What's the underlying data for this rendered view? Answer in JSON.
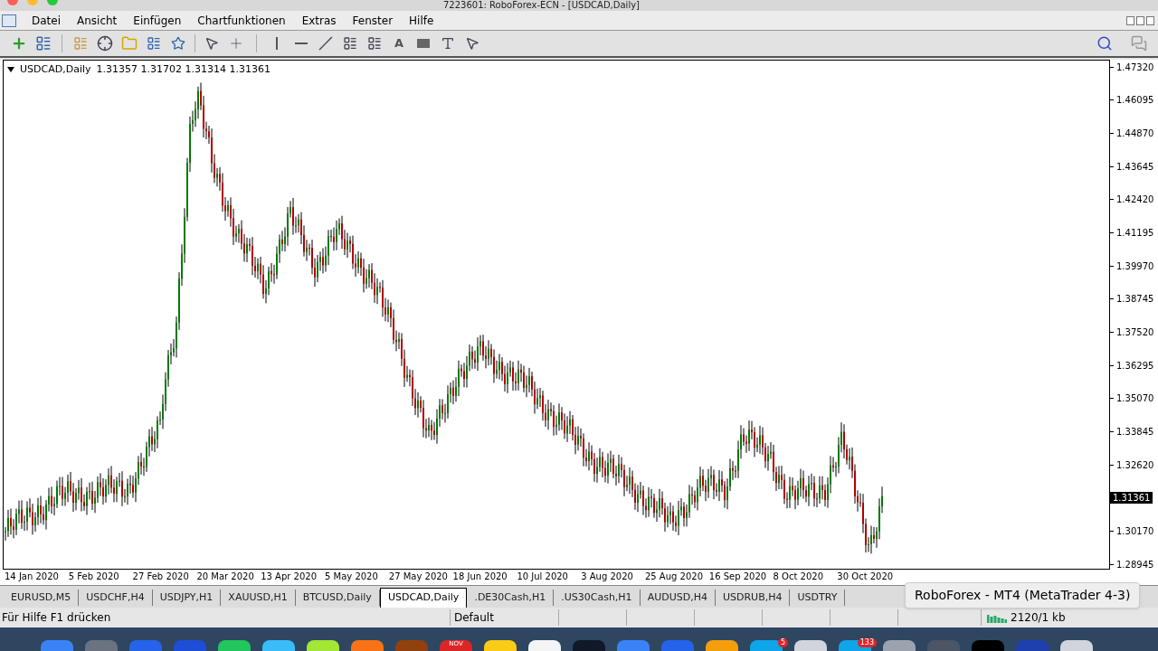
{
  "window": {
    "title": "7223601: RoboForex-ECN - [USDCAD,Daily]"
  },
  "menu": [
    "Datei",
    "Ansicht",
    "Einfügen",
    "Chartfunktionen",
    "Extras",
    "Fenster",
    "Hilfe"
  ],
  "toolbar": {
    "text_tool_label": "A"
  },
  "chart": {
    "symbol": "USDCAD,Daily",
    "ohlc": "1.31357 1.31702 1.31314 1.31361",
    "y_labels": [
      {
        "kind": "tick",
        "label": "1.47320"
      },
      {
        "kind": "tick",
        "label": "1.46095"
      },
      {
        "kind": "tick",
        "label": "1.44870"
      },
      {
        "kind": "tick",
        "label": "1.43645"
      },
      {
        "kind": "tick",
        "label": "1.42420"
      },
      {
        "kind": "tick",
        "label": "1.41195"
      },
      {
        "kind": "tick",
        "label": "1.39970"
      },
      {
        "kind": "tick",
        "label": "1.38745"
      },
      {
        "kind": "tick",
        "label": "1.37520"
      },
      {
        "kind": "tick",
        "label": "1.36295"
      },
      {
        "kind": "tick",
        "label": "1.35070"
      },
      {
        "kind": "tick",
        "label": "1.33845"
      },
      {
        "kind": "tick",
        "label": "1.32620"
      },
      {
        "kind": "current",
        "label": "1.31361"
      },
      {
        "kind": "tick",
        "label": "1.30170"
      },
      {
        "kind": "tick",
        "label": "1.28945"
      }
    ],
    "x_labels": [
      "14 Jan 2020",
      "5 Feb 2020",
      "27 Feb 2020",
      "20 Mar 2020",
      "13 Apr 2020",
      "5 May 2020",
      "27 May 2020",
      "18 Jun 2020",
      "10 Jul 2020",
      "3 Aug 2020",
      "25 Aug 2020",
      "16 Sep 2020",
      "8 Oct 2020",
      "30 Oct 2020"
    ]
  },
  "tabs": [
    {
      "label": "EURUSD,M5",
      "selected": false
    },
    {
      "label": "USDCHF,H4",
      "selected": false
    },
    {
      "label": "USDJPY,H1",
      "selected": false
    },
    {
      "label": "XAUUSD,H1",
      "selected": false
    },
    {
      "label": "BTCUSD,Daily",
      "selected": false
    },
    {
      "label": "USDCAD,Daily",
      "selected": true
    },
    {
      "label": ".DE30Cash,H1",
      "selected": false
    },
    {
      "label": ".US30Cash,H1",
      "selected": false
    },
    {
      "label": "AUDUSD,H4",
      "selected": false
    },
    {
      "label": "USDRUB,H4",
      "selected": false
    },
    {
      "label": "USDTRY",
      "selected": false
    }
  ],
  "tooltip": "RoboForex - MT4 (MetaTrader 4-3)",
  "status_bar": {
    "help": "Für Hilfe F1 drücken",
    "profile": "Default",
    "traffic": "2120/1 kb"
  },
  "dock": [
    {
      "color": "#3b82f6"
    },
    {
      "color": "#6b7280"
    },
    {
      "color": "#2563eb"
    },
    {
      "color": "#1d4ed8"
    },
    {
      "color": "#22c55e"
    },
    {
      "color": "#38bdf8"
    },
    {
      "color": "#a3e635"
    },
    {
      "color": "#f97316"
    },
    {
      "color": "#92400e"
    },
    {
      "color": "#dc2626",
      "label": "NOV"
    },
    {
      "color": "#facc15"
    },
    {
      "color": "#f3f4f6"
    },
    {
      "color": "#111827"
    },
    {
      "color": "#3b82f6"
    },
    {
      "color": "#2563eb"
    },
    {
      "color": "#f59e0b"
    },
    {
      "color": "#0ea5e9",
      "badge": "5"
    },
    {
      "color": "#d1d5db"
    },
    {
      "color": "#0ea5e9",
      "badge": "133"
    },
    {
      "color": "#9ca3af"
    },
    {
      "color": "#4b5563"
    },
    {
      "color": "#000000"
    },
    {
      "color": "#1e40af"
    },
    {
      "color": "#d1d5db"
    }
  ]
}
